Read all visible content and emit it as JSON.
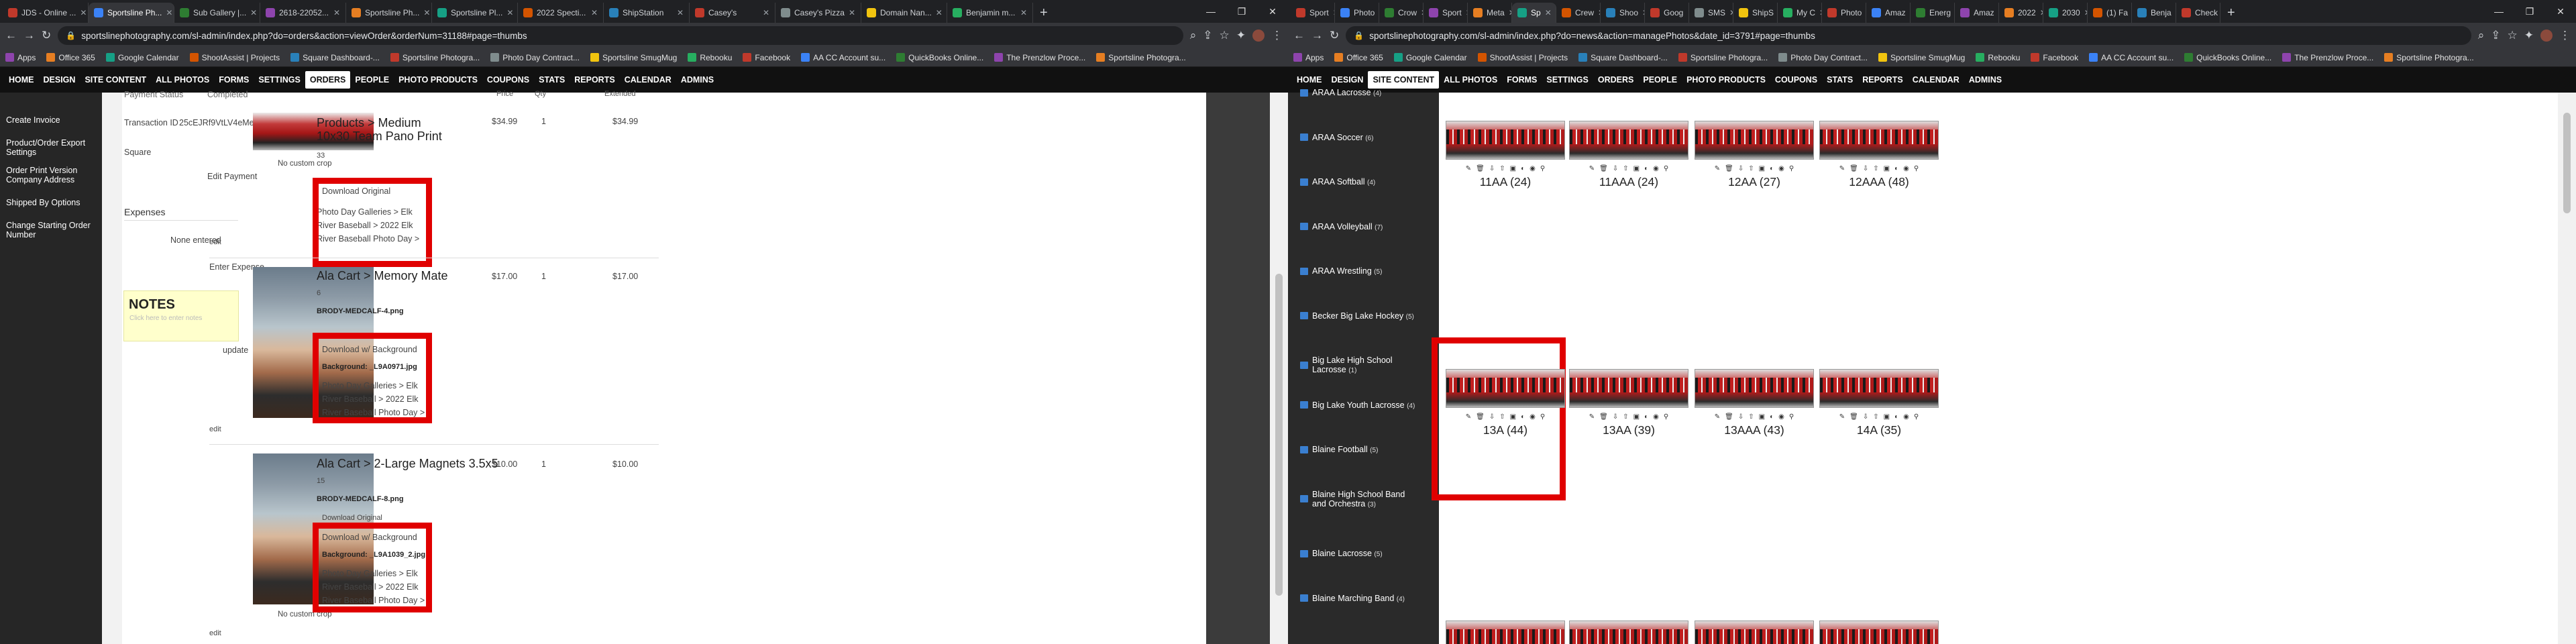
{
  "left_window": {
    "tabs": [
      "JDS - Online ...",
      "Sportsline Ph...",
      "Sub Gallery |...",
      "2618-22052...",
      "Sportsline Ph...",
      "Sportsline Pl...",
      "2022 Specti...",
      "ShipStation",
      "Casey's",
      "Casey's Pizza",
      "Domain Nan...",
      "Benjamin m..."
    ],
    "url": "sportslinephotography.com/sl-admin/index.php?do=orders&action=viewOrder&orderNum=31188#page=thumbs",
    "bookmarks": [
      "Apps",
      "Office 365",
      "Google Calendar",
      "ShootAssist | Projects",
      "Square Dashboard-...",
      "Sportsline Photogra...",
      "Photo Day Contract...",
      "Sportsline SmugMug",
      "Rebooku",
      "Facebook",
      "AA CC Account su...",
      "QuickBooks Online...",
      "The Prenzlow Proce...",
      "Sportsline Photogra..."
    ],
    "nav": [
      "HOME",
      "DESIGN",
      "SITE CONTENT",
      "ALL PHOTOS",
      "FORMS",
      "SETTINGS",
      "ORDERS",
      "PEOPLE",
      "PHOTO PRODUCTS",
      "COUPONS",
      "STATS",
      "REPORTS",
      "CALENDAR",
      "ADMINS"
    ],
    "nav_active": "ORDERS",
    "sidebar": [
      "Create Invoice",
      "Product/Order Export Settings",
      "Order Print Version Company Address",
      "Shipped By Options",
      "Change Starting Order Number"
    ],
    "payment": {
      "status_label": "Payment Status",
      "status_value": "Completed",
      "txn_label": "Transaction ID",
      "txn_value": "25cEJRf9VtLV4eMe9bSbjieV",
      "method": "Square",
      "edit_payment": "Edit Payment"
    },
    "expenses": {
      "title": "Expenses",
      "none": "None entered",
      "enter": "Enter Expense"
    },
    "notes": {
      "title": "NOTES",
      "hint": "Click here to enter notes",
      "update": "update"
    },
    "columns": {
      "price": "Price",
      "qty": "Qty",
      "extended": "Extended"
    },
    "items": [
      {
        "name": "Products > Medium 10x30 Team Pano Print",
        "num": "33",
        "extra": "",
        "note": "No custom crop",
        "dl": "Download Original",
        "bg": "",
        "path": "Photo Day Galleries > Elk River Baseball > 2022 Elk River Baseball Photo Day >",
        "price": "$34.99",
        "qty": "1",
        "ext": "$34.99",
        "edit": "edit"
      },
      {
        "name": "Ala Cart > Memory Mate",
        "num": "6",
        "extra": "BRODY-MEDCALF-4.png",
        "note": "",
        "dl": "Download w/ Background",
        "bg": "Background: _L9A0971.jpg",
        "path": "Photo Day Galleries > Elk River Baseball > 2022 Elk River Baseball Photo Day >",
        "price": "$17.00",
        "qty": "1",
        "ext": "$17.00",
        "edit": "edit"
      },
      {
        "name": "Ala Cart > 2-Large Magnets 3.5x5",
        "num": "15",
        "extra": "BRODY-MEDCALF-8.png",
        "note": "No custom crop",
        "dl": "Download w/ Background",
        "dl2": "Download Original",
        "bg": "Background: _L9A1039_2.jpg",
        "path": "Photo Day Galleries > Elk River Baseball > 2022 Elk River Baseball Photo Day >",
        "price": "$10.00",
        "qty": "1",
        "ext": "$10.00",
        "edit": "edit"
      }
    ]
  },
  "right_window": {
    "url": "sportslinephotography.com/sl-admin/index.php?do=news&action=managePhotos&date_id=3791#page=thumbs",
    "bookmarks": [
      "Apps",
      "Office 365",
      "Google Calendar",
      "ShootAssist | Projects",
      "Square Dashboard-...",
      "Sportsline Photogra...",
      "Photo Day Contract...",
      "Sportsline SmugMug",
      "Rebooku",
      "Facebook",
      "AA CC Account su...",
      "QuickBooks Online...",
      "The Prenzlow Proce...",
      "Sportsline Photogra..."
    ],
    "tabs": [
      "Sport",
      "Photo",
      "Crow",
      "Sport",
      "Meta",
      "Sp",
      "Crew",
      "Shoo",
      "Goog",
      "SMS",
      "ShipS",
      "My C",
      "Photo",
      "Amaz",
      "Energ",
      "Amaz",
      "2022",
      "2030",
      "(1) Fa",
      "Benja",
      "Check"
    ],
    "nav_active": "SITE CONTENT",
    "sidebar": [
      {
        "label": "ARAA Lacrosse",
        "count": "(4)"
      },
      {
        "label": "ARAA Soccer",
        "count": "(6)"
      },
      {
        "label": "ARAA Softball",
        "count": "(4)"
      },
      {
        "label": "ARAA Volleyball",
        "count": "(7)"
      },
      {
        "label": "ARAA Wrestling",
        "count": "(5)"
      },
      {
        "label": "Becker Big Lake Hockey",
        "count": "(5)"
      },
      {
        "label": "Big Lake High School Lacrosse",
        "count": "(1)"
      },
      {
        "label": "Big Lake Youth Lacrosse",
        "count": "(4)"
      },
      {
        "label": "Blaine Football",
        "count": "(5)"
      },
      {
        "label": "Blaine High School Band and Orchestra",
        "count": "(3)"
      },
      {
        "label": "Blaine Lacrosse",
        "count": "(5)"
      },
      {
        "label": "Blaine Marching Band",
        "count": "(4)"
      }
    ],
    "galleries": [
      "11AA (24)",
      "11AAA (24)",
      "12AA (27)",
      "12AAA (48)",
      "13A (44)",
      "13AA (39)",
      "13AAA (43)",
      "14A (35)"
    ]
  }
}
